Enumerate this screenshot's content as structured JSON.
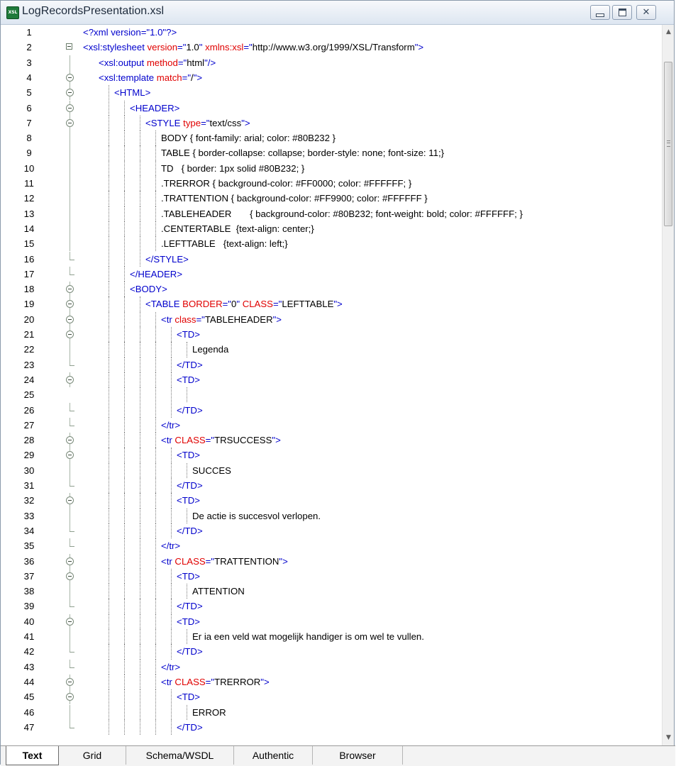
{
  "window": {
    "title": "LogRecordsPresentation.xsl",
    "icon_label": "XSL",
    "buttons": {
      "minimize": "minimize",
      "restore": "restore",
      "close": "close"
    }
  },
  "editor": {
    "lines": [
      {
        "n": "1",
        "indent": 0,
        "fold": "none",
        "tokens": [
          [
            "pi",
            "<?xml version=\"1.0\"?>"
          ]
        ]
      },
      {
        "n": "2",
        "indent": 0,
        "fold": "box",
        "tokens": [
          [
            "tag",
            "<xsl:stylesheet "
          ],
          [
            "att",
            "version"
          ],
          [
            "tag",
            "=\""
          ],
          [
            "val",
            "1.0"
          ],
          [
            "tag",
            "\" "
          ],
          [
            "att",
            "xmlns:xsl"
          ],
          [
            "tag",
            "=\""
          ],
          [
            "val",
            "http://www.w3.org/1999/XSL/Transform"
          ],
          [
            "tag",
            "\">"
          ]
        ]
      },
      {
        "n": "3",
        "indent": 1,
        "fold": "line",
        "tokens": [
          [
            "tag",
            "<xsl:output "
          ],
          [
            "att",
            "method"
          ],
          [
            "tag",
            "=\""
          ],
          [
            "val",
            "html"
          ],
          [
            "tag",
            "\"/>"
          ]
        ]
      },
      {
        "n": "4",
        "indent": 1,
        "fold": "circle",
        "tokens": [
          [
            "tag",
            "<xsl:template "
          ],
          [
            "att",
            "match"
          ],
          [
            "tag",
            "=\""
          ],
          [
            "val",
            "/"
          ],
          [
            "tag",
            "\">"
          ]
        ]
      },
      {
        "n": "5",
        "indent": 2,
        "fold": "circle",
        "tokens": [
          [
            "tag",
            "<HTML>"
          ]
        ]
      },
      {
        "n": "6",
        "indent": 3,
        "fold": "circle",
        "tokens": [
          [
            "tag",
            "<HEADER>"
          ]
        ]
      },
      {
        "n": "7",
        "indent": 4,
        "fold": "circle",
        "tokens": [
          [
            "tag",
            "<STYLE "
          ],
          [
            "att",
            "type"
          ],
          [
            "tag",
            "=\""
          ],
          [
            "val",
            "text/css"
          ],
          [
            "tag",
            "\">"
          ]
        ]
      },
      {
        "n": "8",
        "indent": 5,
        "fold": "line",
        "tokens": [
          [
            "val",
            "BODY { font-family: arial; color: #80B232 }"
          ]
        ]
      },
      {
        "n": "9",
        "indent": 5,
        "fold": "line",
        "tokens": [
          [
            "val",
            "TABLE { border-collapse: collapse; border-style: none; font-size: 11;}"
          ]
        ]
      },
      {
        "n": "10",
        "indent": 5,
        "fold": "line",
        "tokens": [
          [
            "val",
            "TD   { border: 1px solid #80B232; }"
          ]
        ]
      },
      {
        "n": "11",
        "indent": 5,
        "fold": "line",
        "tokens": [
          [
            "val",
            ".TRERROR { background-color: #FF0000; color: #FFFFFF; }"
          ]
        ]
      },
      {
        "n": "12",
        "indent": 5,
        "fold": "line",
        "tokens": [
          [
            "val",
            ".TRATTENTION { background-color: #FF9900; color: #FFFFFF }"
          ]
        ]
      },
      {
        "n": "13",
        "indent": 5,
        "fold": "line",
        "tokens": [
          [
            "val",
            ".TABLEHEADER       { background-color: #80B232; font-weight: bold; color: #FFFFFF; }"
          ]
        ]
      },
      {
        "n": "14",
        "indent": 5,
        "fold": "line",
        "tokens": [
          [
            "val",
            ".CENTERTABLE  {text-align: center;}"
          ]
        ]
      },
      {
        "n": "15",
        "indent": 5,
        "fold": "line",
        "tokens": [
          [
            "val",
            ".LEFTTABLE   {text-align: left;}"
          ]
        ]
      },
      {
        "n": "16",
        "indent": 4,
        "fold": "end",
        "tokens": [
          [
            "tag",
            "</STYLE>"
          ]
        ]
      },
      {
        "n": "17",
        "indent": 3,
        "fold": "end",
        "tokens": [
          [
            "tag",
            "</HEADER>"
          ]
        ]
      },
      {
        "n": "18",
        "indent": 3,
        "fold": "circle",
        "tokens": [
          [
            "tag",
            "<BODY>"
          ]
        ]
      },
      {
        "n": "19",
        "indent": 4,
        "fold": "circle",
        "tokens": [
          [
            "tag",
            "<TABLE "
          ],
          [
            "att",
            "BORDER"
          ],
          [
            "tag",
            "=\""
          ],
          [
            "val",
            "0"
          ],
          [
            "tag",
            "\" "
          ],
          [
            "att",
            "CLASS"
          ],
          [
            "tag",
            "=\""
          ],
          [
            "val",
            "LEFTTABLE"
          ],
          [
            "tag",
            "\">"
          ]
        ]
      },
      {
        "n": "20",
        "indent": 5,
        "fold": "circle",
        "tokens": [
          [
            "tag",
            "<tr "
          ],
          [
            "att",
            "class"
          ],
          [
            "tag",
            "=\""
          ],
          [
            "val",
            "TABLEHEADER"
          ],
          [
            "tag",
            "\">"
          ]
        ]
      },
      {
        "n": "21",
        "indent": 6,
        "fold": "circle",
        "tokens": [
          [
            "tag",
            "<TD>"
          ]
        ]
      },
      {
        "n": "22",
        "indent": 7,
        "fold": "line",
        "tokens": [
          [
            "val",
            "Legenda"
          ]
        ]
      },
      {
        "n": "23",
        "indent": 6,
        "fold": "end",
        "tokens": [
          [
            "tag",
            "</TD>"
          ]
        ]
      },
      {
        "n": "24",
        "indent": 6,
        "fold": "circle",
        "tokens": [
          [
            "tag",
            "<TD>"
          ]
        ]
      },
      {
        "n": "25",
        "indent": 0,
        "fold": "none",
        "tokens": []
      },
      {
        "n": "26",
        "indent": 6,
        "fold": "end",
        "tokens": [
          [
            "tag",
            "</TD>"
          ]
        ]
      },
      {
        "n": "27",
        "indent": 5,
        "fold": "end",
        "tokens": [
          [
            "tag",
            "</tr>"
          ]
        ]
      },
      {
        "n": "28",
        "indent": 5,
        "fold": "circle",
        "tokens": [
          [
            "tag",
            "<tr "
          ],
          [
            "att",
            "CLASS"
          ],
          [
            "tag",
            "=\""
          ],
          [
            "val",
            "TRSUCCESS"
          ],
          [
            "tag",
            "\">"
          ]
        ]
      },
      {
        "n": "29",
        "indent": 6,
        "fold": "circle",
        "tokens": [
          [
            "tag",
            "<TD>"
          ]
        ]
      },
      {
        "n": "30",
        "indent": 7,
        "fold": "line",
        "tokens": [
          [
            "val",
            "SUCCES"
          ]
        ]
      },
      {
        "n": "31",
        "indent": 6,
        "fold": "end",
        "tokens": [
          [
            "tag",
            "</TD>"
          ]
        ]
      },
      {
        "n": "32",
        "indent": 6,
        "fold": "circle",
        "tokens": [
          [
            "tag",
            "<TD>"
          ]
        ]
      },
      {
        "n": "33",
        "indent": 7,
        "fold": "line",
        "tokens": [
          [
            "val",
            "De actie is succesvol verlopen."
          ]
        ]
      },
      {
        "n": "34",
        "indent": 6,
        "fold": "end",
        "tokens": [
          [
            "tag",
            "</TD>"
          ]
        ]
      },
      {
        "n": "35",
        "indent": 5,
        "fold": "end",
        "tokens": [
          [
            "tag",
            "</tr>"
          ]
        ]
      },
      {
        "n": "36",
        "indent": 5,
        "fold": "circle",
        "tokens": [
          [
            "tag",
            "<tr "
          ],
          [
            "att",
            "CLASS"
          ],
          [
            "tag",
            "=\""
          ],
          [
            "val",
            "TRATTENTION"
          ],
          [
            "tag",
            "\">"
          ]
        ]
      },
      {
        "n": "37",
        "indent": 6,
        "fold": "circle",
        "tokens": [
          [
            "tag",
            "<TD>"
          ]
        ]
      },
      {
        "n": "38",
        "indent": 7,
        "fold": "line",
        "tokens": [
          [
            "val",
            "ATTENTION"
          ]
        ]
      },
      {
        "n": "39",
        "indent": 6,
        "fold": "end",
        "tokens": [
          [
            "tag",
            "</TD>"
          ]
        ]
      },
      {
        "n": "40",
        "indent": 6,
        "fold": "circle",
        "tokens": [
          [
            "tag",
            "<TD>"
          ]
        ]
      },
      {
        "n": "41",
        "indent": 7,
        "fold": "line",
        "tokens": [
          [
            "val",
            "Er ia een veld wat mogelijk handiger is om wel te vullen."
          ]
        ]
      },
      {
        "n": "42",
        "indent": 6,
        "fold": "end",
        "tokens": [
          [
            "tag",
            "</TD>"
          ]
        ]
      },
      {
        "n": "43",
        "indent": 5,
        "fold": "end",
        "tokens": [
          [
            "tag",
            "</tr>"
          ]
        ]
      },
      {
        "n": "44",
        "indent": 5,
        "fold": "circle",
        "tokens": [
          [
            "tag",
            "<tr "
          ],
          [
            "att",
            "CLASS"
          ],
          [
            "tag",
            "=\""
          ],
          [
            "val",
            "TRERROR"
          ],
          [
            "tag",
            "\">"
          ]
        ]
      },
      {
        "n": "45",
        "indent": 6,
        "fold": "circle",
        "tokens": [
          [
            "tag",
            "<TD>"
          ]
        ]
      },
      {
        "n": "46",
        "indent": 7,
        "fold": "line",
        "tokens": [
          [
            "val",
            "ERROR"
          ]
        ]
      },
      {
        "n": "47",
        "indent": 6,
        "fold": "end",
        "tokens": [
          [
            "tag",
            "</TD>"
          ]
        ]
      }
    ]
  },
  "scrollbar": {
    "up_arrow": "▲",
    "down_arrow": "▼"
  },
  "tabs": [
    {
      "label": "Text",
      "active": true
    },
    {
      "label": "Grid",
      "active": false
    },
    {
      "label": "Schema/WSDL",
      "active": false
    },
    {
      "label": "Authentic",
      "active": false
    },
    {
      "label": "Browser",
      "active": false
    }
  ],
  "colors": {
    "tag": "#0000cc",
    "attribute": "#e00000",
    "value": "#000000"
  }
}
